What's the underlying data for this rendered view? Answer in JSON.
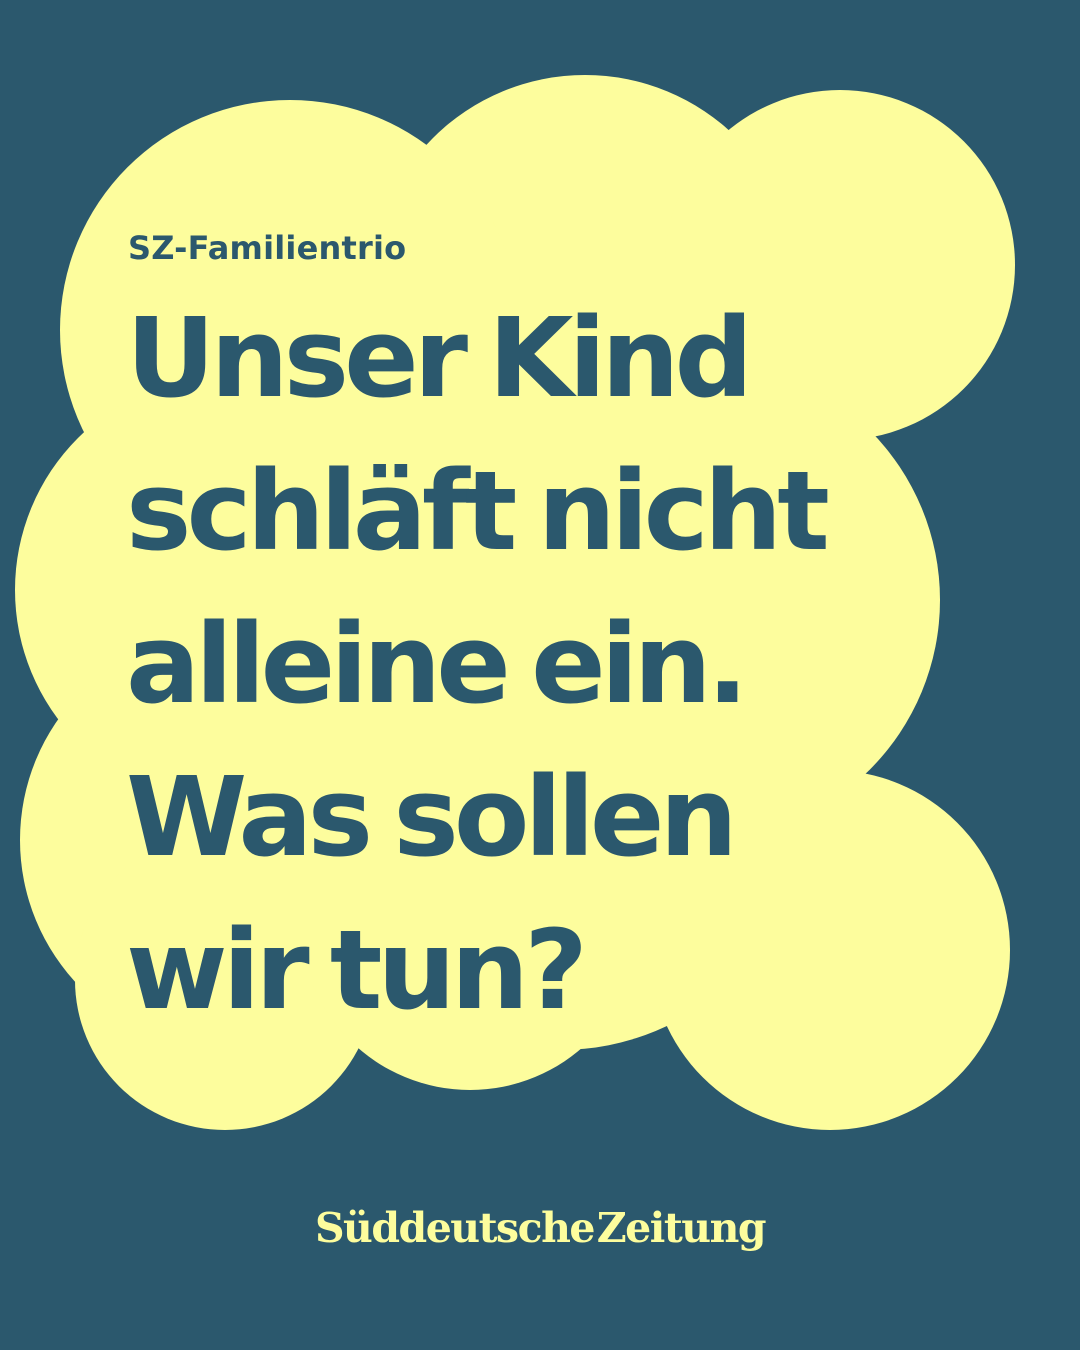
{
  "colors": {
    "background": "#2b586d",
    "cloud": "#fdfd9d",
    "text_dark": "#2b586d",
    "text_light": "#fdfd9d"
  },
  "kicker": "SZ-Familientrio",
  "headline": {
    "lines": [
      "Unser Kind",
      "schläft nicht",
      "alleine ein.",
      "Was sollen",
      "wir tun?"
    ]
  },
  "brand": {
    "name": "Süddeutsche Zeitung"
  }
}
